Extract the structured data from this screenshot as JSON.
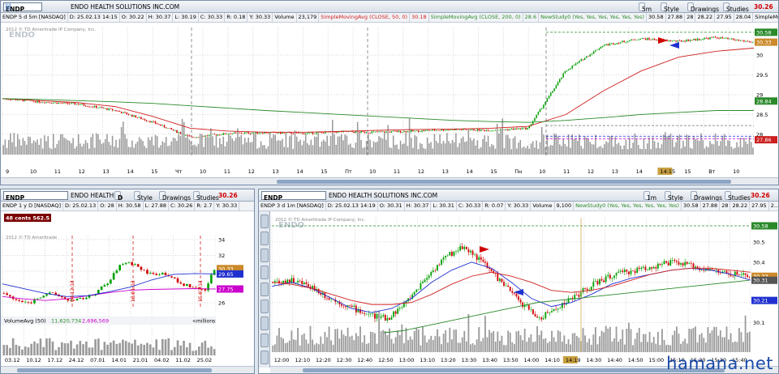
{
  "colors": {
    "up": "#00a000",
    "down": "#d00000",
    "sma50": "#d02020",
    "sma200": "#2a8a2a",
    "study": "#2030d0",
    "magenta": "#cc00cc",
    "volume": "#9a9a9a"
  },
  "top": {
    "symbol": "ENDP",
    "company": "ENDO HEALTH SOLUTIONS INC.COM",
    "timeframe_button": "5m",
    "style": "Style",
    "drawings": "Drawings",
    "studies": "Studies",
    "price": "30.26",
    "info": [
      "ENDP 5 d 5m [NASDAQ]",
      "D: 25.02.13 14:15",
      "O: 30.22",
      "H: 30.37",
      "L: 30.19",
      "C: 30.33",
      "R: 0.18",
      "Y: 30.33",
      "Volume",
      "23,179",
      "SimpleMovingAvg (CLOSE, 50, 0)",
      "30.18",
      "SimpleMovingAvg (CLOSE, 200, 0)",
      "28.6",
      "NewStudy0 (Yes, Yes, Yes, Yes, Yes, Yes)",
      "30.58",
      "27.88",
      "28",
      "28.22",
      "27.95",
      "28.04",
      "SimpleMoving..."
    ],
    "copyright": "2012 © TD Ameritrade IP Company, Inc.",
    "watermark": "ENDO",
    "price_labels": [
      "30.58",
      "30.33",
      "30",
      "29.5",
      "29",
      "28.84",
      "28.5",
      "28",
      "27.86"
    ],
    "time_labels": [
      "9",
      "10",
      "11",
      "12",
      "13",
      "14",
      "15",
      "Чт",
      "10",
      "11",
      "12",
      "13",
      "14",
      "15",
      "Пт",
      "10",
      "11",
      "12",
      "13",
      "14",
      "15",
      "Пн",
      "10",
      "11",
      "12",
      "13",
      "14",
      "14:15",
      "15",
      "Вт",
      "10"
    ]
  },
  "left": {
    "symbol": "ENDP",
    "company": "ENDO HEALTH...",
    "mode": "D",
    "style": "Style",
    "drawings": "Drawings",
    "studies": "Studies",
    "price": "30.26",
    "right_small": [
      "+2.22",
      "+7.91%"
    ],
    "info": [
      "ENDP 1 y D [NASDAQ]",
      "D: 25.02.13",
      "O: 28",
      "H: 30.58",
      "L: 27.88",
      "C: 30.26",
      "R: 2.7",
      "Y: 30.33"
    ],
    "badge": "48 cents 562.5 %",
    "copyright": "2012 © TD Ameritrade",
    "price_labels": [
      "34",
      "32",
      "30.33",
      "29.65",
      "28",
      "27.75",
      "26"
    ],
    "date_markers": [
      "04.12.13",
      "18.01.13",
      "15.02.13"
    ],
    "volume": {
      "label": "VolumeAvg (50)",
      "v1": "11,620,734",
      "v2": "2,696,569",
      "units": "<millions>",
      "scale": [
        "10",
        "5"
      ],
      "vals": [
        "11.6207",
        "2.6966"
      ]
    },
    "time_labels": [
      "03.12",
      "10.12",
      "17.12",
      "24.12",
      "07.01",
      "14.01",
      "21.01",
      "04.02",
      "11.02",
      "25.02"
    ]
  },
  "right": {
    "symbol": "ENDP",
    "company": "ENDO HEALTH SOLUTIONS INC.COM",
    "timeframe_button": "1m",
    "style": "Style",
    "drawings": "Drawings",
    "studies": "Studies",
    "price": "30.26",
    "info": [
      "ENDP 3 d 1m [NASDAQ]",
      "D: 25.02.13 14:19",
      "O: 30.31",
      "H: 30.37",
      "L: 30.31",
      "C: 30.33",
      "R: 0.07",
      "Y: 30.33",
      "Volume",
      "9,100",
      "NewStudy0 (Yes, Yes, Yes, Yes, Yes, Yes)",
      "30.58",
      "27.88",
      "28",
      "28.22",
      "27.95",
      "2..."
    ],
    "copyright": "2012 © TD Ameritrade IP Company, Inc.",
    "watermark": "ENDO",
    "price_labels": [
      "30.58",
      "30.5",
      "30.4",
      "30.33",
      "30.31",
      "30.3",
      "30.21",
      "30.1"
    ],
    "time_labels": [
      "12:00",
      "12:10",
      "12:20",
      "12:30",
      "12:40",
      "12:50",
      "13:00",
      "13:10",
      "13:20",
      "13:30",
      "13:40",
      "13:50",
      "14:00",
      "14:10",
      "14:19",
      "14:30",
      "14:40",
      "14:50",
      "15:00",
      "15:10",
      "15:20",
      "15:30",
      "15:40"
    ],
    "side_tools": [
      "B",
      "C",
      "D",
      "E",
      "F",
      "G",
      "H",
      "I",
      "J"
    ]
  },
  "site": "hamana.net",
  "chart_data": [
    {
      "type": "line",
      "title": "ENDP 5 d 5m [NASDAQ]",
      "series": [
        {
          "name": "SimpleMovingAvg (CLOSE, 50, 0)",
          "values": [
            28.9,
            28.85,
            28.8,
            28.7,
            28.45,
            28.15,
            28.08,
            28.05,
            28.05,
            28.07,
            28.1,
            28.12,
            28.13,
            28.15,
            28.2,
            28.5,
            29.1,
            29.6,
            29.95,
            30.1,
            30.18
          ]
        },
        {
          "name": "SimpleMovingAvg (CLOSE, 200, 0)",
          "values": [
            28.9,
            28.88,
            28.85,
            28.82,
            28.78,
            28.72,
            28.66,
            28.6,
            28.55,
            28.5,
            28.45,
            28.4,
            28.35,
            28.32,
            28.3,
            28.35,
            28.42,
            28.5,
            28.55,
            28.6,
            28.6
          ]
        },
        {
          "name": "Close",
          "values": [
            28.9,
            28.82,
            28.76,
            28.6,
            28.3,
            27.92,
            28.02,
            28.04,
            28.02,
            28.06,
            28.05,
            28.08,
            28.12,
            28.1,
            28.15,
            29.6,
            30.25,
            30.42,
            30.35,
            30.45,
            30.33
          ]
        }
      ],
      "ylim": [
        27.75,
        30.7
      ]
    },
    {
      "type": "line",
      "title": "ENDP 1 y D [NASDAQ]",
      "series": [
        {
          "name": "Close",
          "values": [
            27.2,
            26.5,
            26.1,
            26.0,
            26.8,
            27.2,
            27.0,
            26.5,
            26.2,
            26.6,
            26.9,
            27.8,
            28.6,
            30.5,
            31.2,
            30.8,
            30.0,
            29.6,
            29.8,
            29.4,
            28.4,
            28.2,
            27.8,
            27.75,
            30.26
          ]
        }
      ],
      "ylim": [
        25.5,
        34.5
      ]
    },
    {
      "type": "line",
      "title": "ENDP 3 d 1m [NASDAQ]",
      "series": [
        {
          "name": "Close",
          "values": [
            30.3,
            30.31,
            30.28,
            30.22,
            30.18,
            30.14,
            30.12,
            30.2,
            30.32,
            30.42,
            30.48,
            30.4,
            30.3,
            30.2,
            30.12,
            30.18,
            30.24,
            30.3,
            30.34,
            30.36,
            30.38,
            30.4,
            30.38,
            30.36,
            30.34,
            30.33
          ]
        }
      ],
      "ylim": [
        30.05,
        30.62
      ]
    }
  ]
}
